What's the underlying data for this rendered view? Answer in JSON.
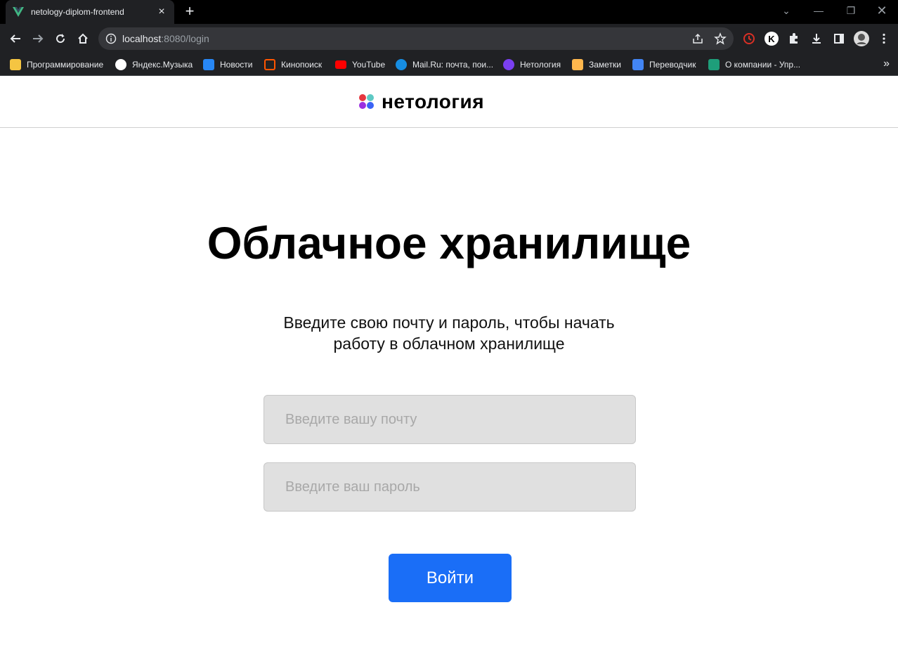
{
  "browser": {
    "tab_title": "netology-diplom-frontend",
    "url_host": "localhost",
    "url_rest": ":8080/login",
    "bookmarks": [
      {
        "label": "Программирование",
        "color": "#f5c542"
      },
      {
        "label": "Яндекс.Музыка",
        "color": "#ffffff"
      },
      {
        "label": "Новости",
        "color": "#2787f5"
      },
      {
        "label": "Кинопоиск",
        "color": "#ff5500"
      },
      {
        "label": "YouTube",
        "color": "#ff0000"
      },
      {
        "label": "Mail.Ru: почта, пои...",
        "color": "#168de2"
      },
      {
        "label": "Нетология",
        "color": "#7a3ff0"
      },
      {
        "label": "Заметки",
        "color": "#ffb74d"
      },
      {
        "label": "Переводчик",
        "color": "#4285f4"
      },
      {
        "label": "О компании - Упр...",
        "color": "#1e9e7a"
      }
    ],
    "bookmarks_more": "»"
  },
  "site": {
    "logo_text": "нетология",
    "title": "Облачное хранилище",
    "subtitle_line1": "Введите свою почту и пароль, чтобы начать",
    "subtitle_line2": "работу в облачном хранилище",
    "email_placeholder": "Введите вашу почту",
    "password_placeholder": "Введите ваш пароль",
    "login_button": "Войти",
    "accent_color": "#1a6ef7"
  }
}
